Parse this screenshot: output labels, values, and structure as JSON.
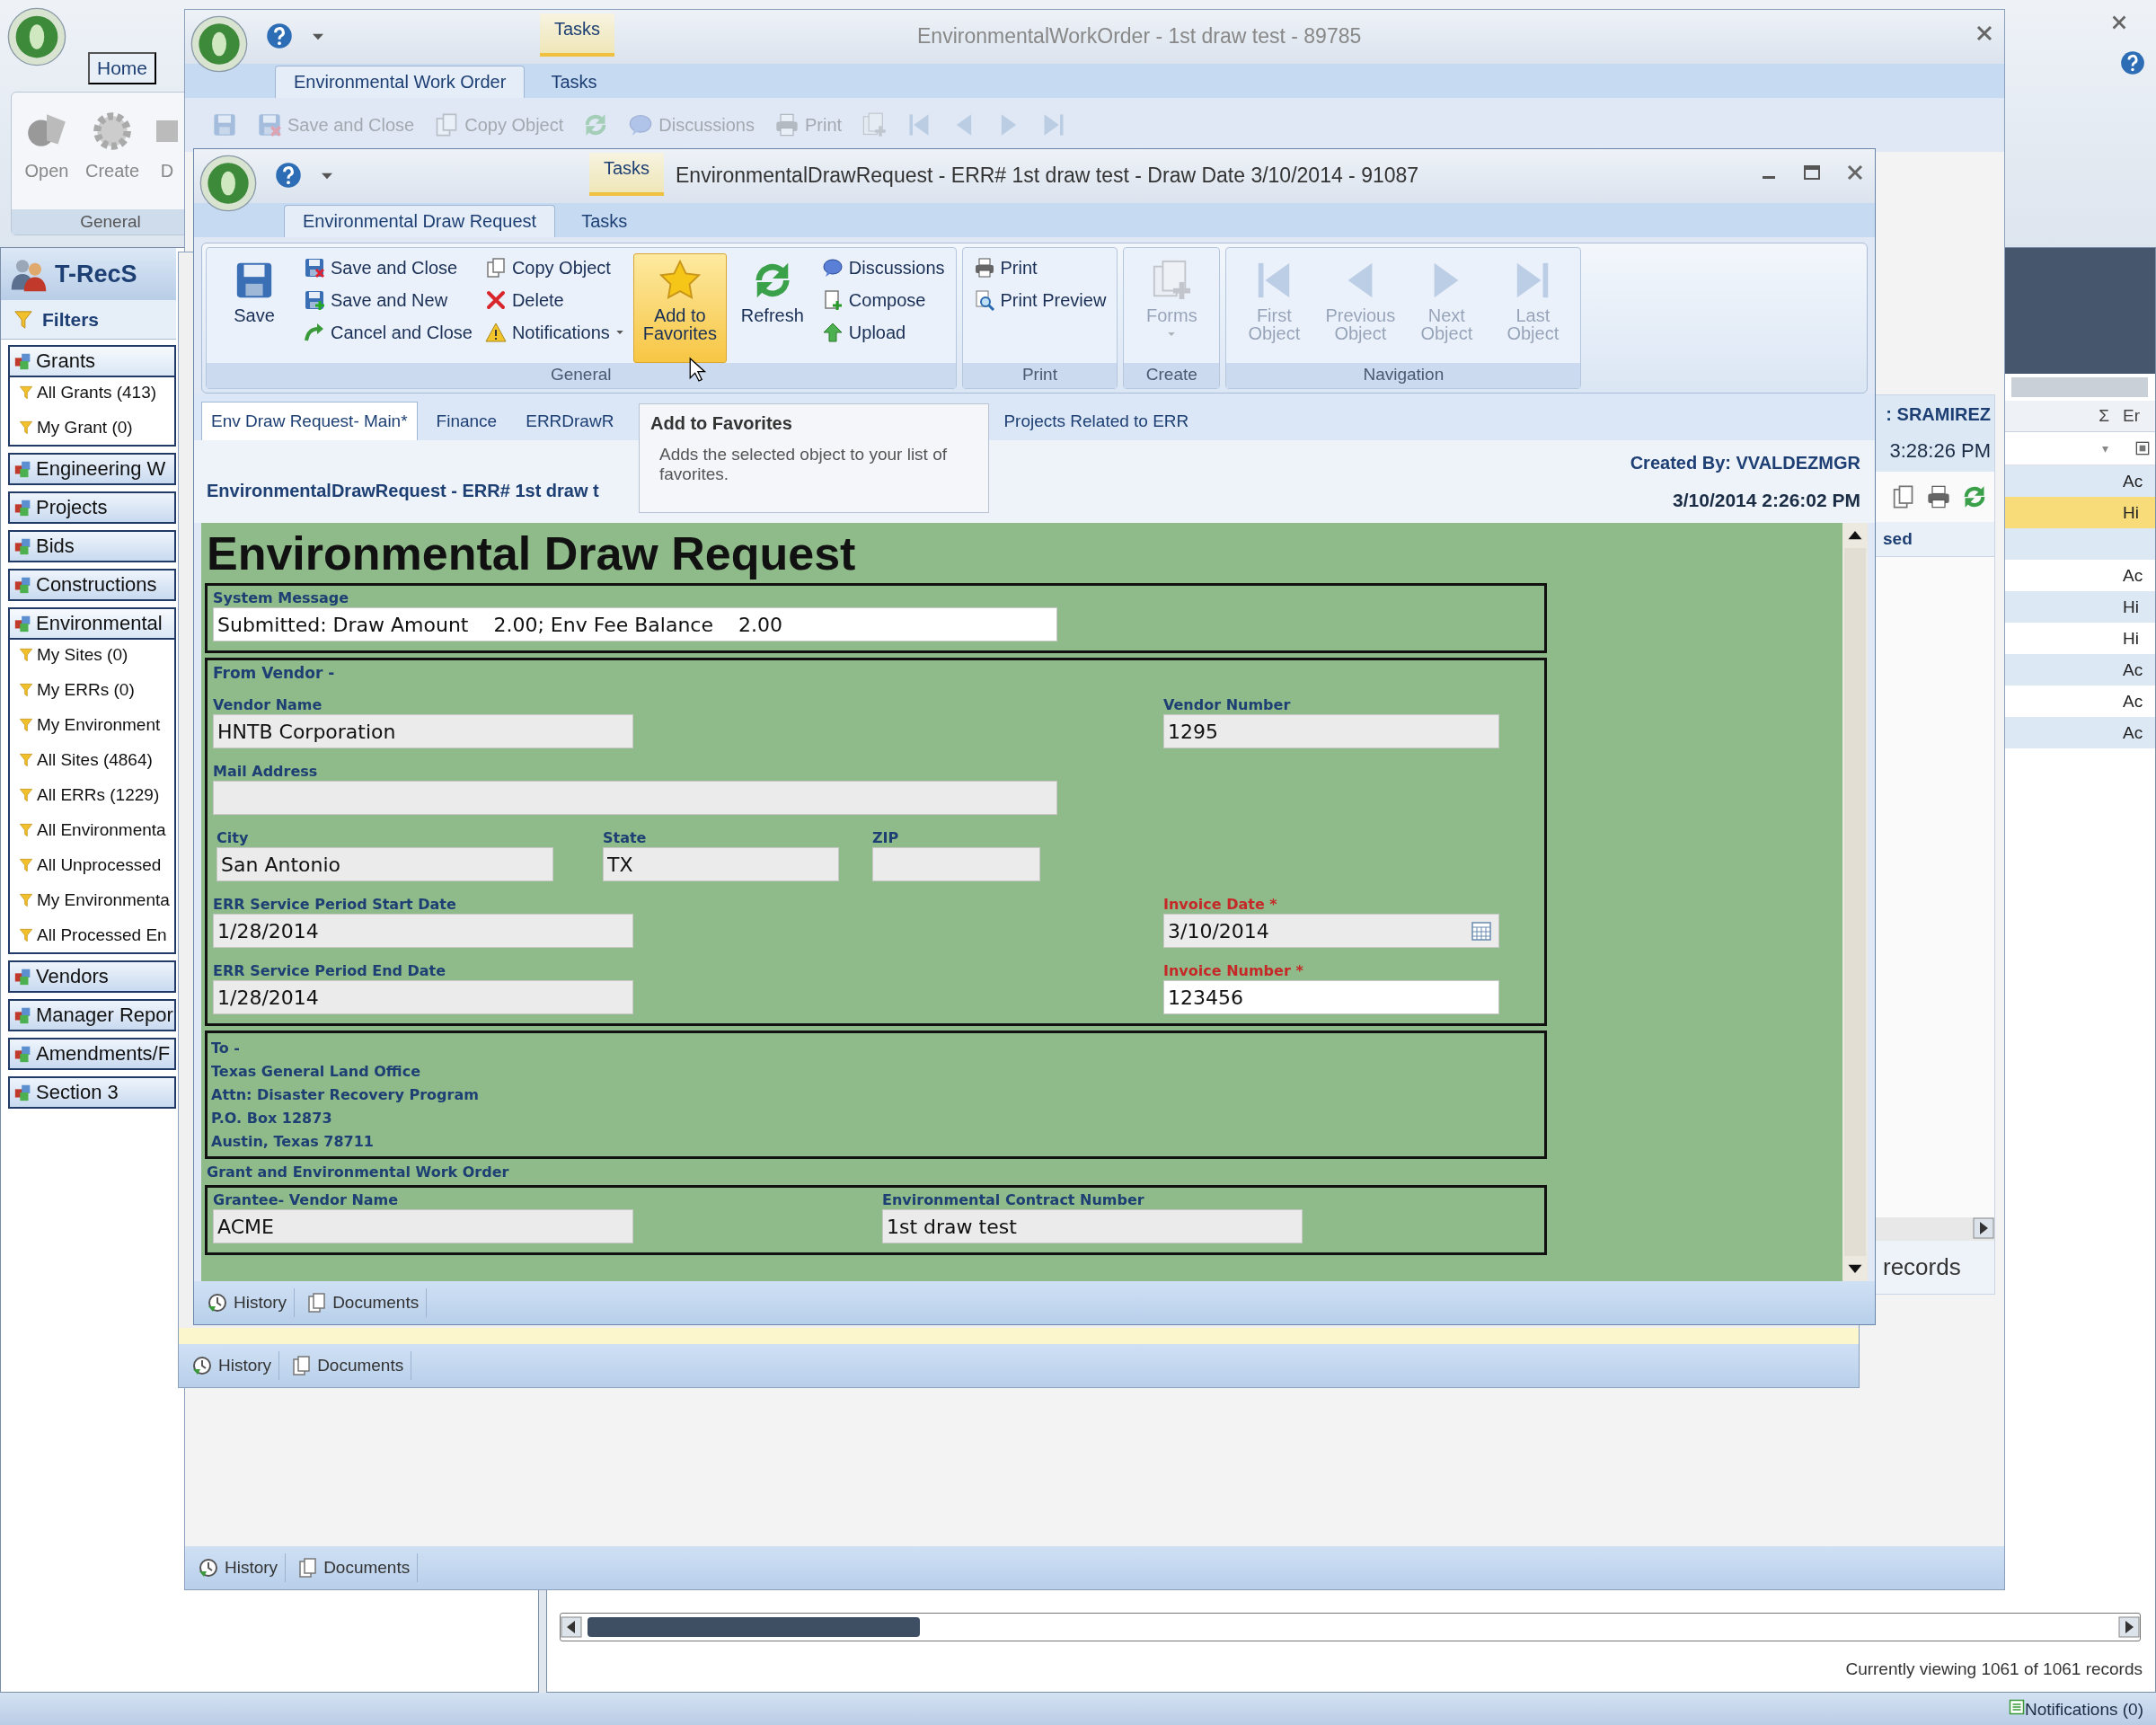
{
  "app": {
    "tabs": [
      {
        "label": "Home",
        "selected": true
      }
    ],
    "ribbon": {
      "buttons": [
        {
          "label": "Open",
          "kind": "open"
        },
        {
          "label": "Create",
          "kind": "create"
        },
        {
          "label": "D",
          "kind": "cut"
        }
      ],
      "group": "General"
    },
    "sidebar": {
      "title": "T-RecS",
      "filters": "Filters",
      "groups": [
        {
          "label": "Grants",
          "expanded": true,
          "children": [
            {
              "label": "All Grants (413)"
            },
            {
              "label": "My Grant (0)"
            }
          ]
        },
        {
          "label": "Engineering W",
          "expanded": false
        },
        {
          "label": "Projects",
          "expanded": false
        },
        {
          "label": "Bids",
          "expanded": false
        },
        {
          "label": "Constructions",
          "expanded": false
        },
        {
          "label": "Environmental",
          "expanded": true,
          "children": [
            {
              "label": "My Sites (0)"
            },
            {
              "label": "My ERRs (0)"
            },
            {
              "label": "My Environment"
            },
            {
              "label": "All Sites (4864)"
            },
            {
              "label": "All ERRs (1229)"
            },
            {
              "label": "All Environmenta"
            },
            {
              "label": "All Unprocessed"
            },
            {
              "label": "My Environmenta"
            },
            {
              "label": "All Processed En"
            }
          ]
        },
        {
          "label": "Vendors",
          "expanded": false
        },
        {
          "label": "Manager Repor",
          "expanded": false
        },
        {
          "label": "Amendments/F",
          "expanded": false
        },
        {
          "label": "Section 3",
          "expanded": false
        }
      ]
    },
    "grid": {
      "columns": [
        "Σ",
        "Er"
      ],
      "filter_caret": "▾",
      "rows": [
        {
          "text": "Ac",
          "selected": false
        },
        {
          "text": "Hi",
          "selected": true
        },
        {
          "selected": false
        },
        {
          "text": "Ac",
          "selected": false
        },
        {
          "text": "Hi",
          "selected": false
        },
        {
          "text": "Hi",
          "selected": false
        },
        {
          "text": "Ac",
          "selected": false
        },
        {
          "text": "Ac",
          "selected": false
        },
        {
          "text": "Ac",
          "selected": false
        }
      ]
    },
    "grid_status": "Currently viewing 1061 of 1061 records",
    "status_bar": {
      "notifications": "Notifications (0)"
    }
  },
  "work_order_window": {
    "title": "EnvironmentalWorkOrder - 1st draw test - 89785",
    "context_tab": "Tasks",
    "tabs": [
      {
        "label": "Environmental Work Order",
        "selected": true
      },
      {
        "label": "Tasks",
        "selected": false
      }
    ],
    "toolbar": [
      {
        "kind": "save",
        "disabled": true
      },
      {
        "label": "Save and Close",
        "kind": "save-close",
        "disabled": true
      },
      {
        "label": "Copy Object",
        "kind": "copy",
        "disabled": true
      },
      {
        "kind": "refresh",
        "disabled": true
      },
      {
        "label": "Discussions",
        "kind": "discussions",
        "disabled": true
      },
      {
        "label": "Print",
        "kind": "print",
        "disabled": true
      },
      {
        "kind": "forms",
        "disabled": true
      },
      {
        "kind": "first",
        "disabled": true
      },
      {
        "kind": "previous",
        "disabled": true
      },
      {
        "kind": "next",
        "disabled": true
      },
      {
        "kind": "last",
        "disabled": true
      }
    ],
    "panel": {
      "user": ": SRAMIREZ",
      "time": "3:28:26 PM",
      "column": "sed",
      "footer": "records"
    },
    "bottom_tabs": [
      "History",
      "Documents"
    ]
  },
  "middle_window": {
    "bottom_tabs": [
      "History",
      "Documents"
    ]
  },
  "draw_request_window": {
    "title": "EnvironmentalDrawRequest - ERR# 1st draw test - Draw Date 3/10/2014 - 91087",
    "context_tab": "Tasks",
    "tabs": [
      {
        "label": "Environmental Draw Request",
        "selected": true
      },
      {
        "label": "Tasks",
        "selected": false
      }
    ],
    "ribbon": [
      {
        "label": "General",
        "columns": [
          {
            "kind": "large",
            "buttons": [
              {
                "label": "Save",
                "kind": "save",
                "disabled": false,
                "hovered": false
              }
            ]
          },
          {
            "kind": "stack",
            "buttons": [
              {
                "label": "Save and Close",
                "kind": "save-close",
                "disabled": false,
                "hovered": false
              },
              {
                "label": "Save and New",
                "kind": "save-new",
                "disabled": false,
                "hovered": false
              },
              {
                "label": "Cancel and Close",
                "kind": "cancel-close",
                "disabled": false,
                "hovered": false
              }
            ]
          },
          {
            "kind": "stack",
            "buttons": [
              {
                "label": "Copy Object",
                "kind": "copy",
                "disabled": false,
                "hovered": false
              },
              {
                "label": "Delete",
                "kind": "delete",
                "disabled": false,
                "hovered": false
              },
              {
                "label": "Notifications",
                "kind": "notifications",
                "disabled": false,
                "hovered": false
              }
            ]
          },
          {
            "kind": "large",
            "buttons": [
              {
                "label": "Add to Favorites",
                "kind": "favorites",
                "disabled": false,
                "hovered": true
              }
            ]
          },
          {
            "kind": "large",
            "buttons": [
              {
                "label": "Refresh",
                "kind": "refresh",
                "disabled": false,
                "hovered": false
              }
            ]
          },
          {
            "kind": "stack",
            "buttons": [
              {
                "label": "Discussions",
                "kind": "discussions",
                "disabled": false,
                "hovered": false
              },
              {
                "label": "Compose",
                "kind": "compose",
                "disabled": false,
                "hovered": false
              },
              {
                "label": "Upload",
                "kind": "upload",
                "disabled": false,
                "hovered": false
              }
            ]
          }
        ]
      },
      {
        "label": "Print",
        "columns": [
          {
            "kind": "stack",
            "buttons": [
              {
                "label": "Print",
                "kind": "print",
                "disabled": false,
                "hovered": false
              },
              {
                "label": "Print Preview",
                "kind": "preview",
                "disabled": false,
                "hovered": false
              }
            ]
          }
        ]
      },
      {
        "label": "Create",
        "columns": [
          {
            "kind": "large",
            "buttons": [
              {
                "label": "Forms",
                "kind": "forms",
                "disabled": true,
                "hovered": false
              }
            ]
          }
        ]
      },
      {
        "label": "Navigation",
        "columns": [
          {
            "kind": "large",
            "buttons": [
              {
                "label": "First Object",
                "kind": "first",
                "disabled": true,
                "hovered": false
              }
            ]
          },
          {
            "kind": "large",
            "buttons": [
              {
                "label": "Previous Object",
                "kind": "previous",
                "disabled": true,
                "hovered": false
              }
            ]
          },
          {
            "kind": "large",
            "buttons": [
              {
                "label": "Next Object",
                "kind": "next",
                "disabled": true,
                "hovered": false
              }
            ]
          },
          {
            "kind": "large",
            "buttons": [
              {
                "label": "Last Object",
                "kind": "last",
                "disabled": true,
                "hovered": false
              }
            ]
          }
        ]
      }
    ],
    "tooltip": {
      "title": "Add to Favorites",
      "text": "Adds the selected object to your list of favorites."
    },
    "page_tabs": [
      {
        "label": "Env Draw Request- Main*",
        "selected": true
      },
      {
        "label": "Finance",
        "selected": false
      },
      {
        "label": "ERRDrawR",
        "selected": false
      },
      {
        "label": "Projects Related to ERR",
        "selected": false
      }
    ],
    "header": {
      "caption": "EnvironmentalDrawRequest - ERR# 1st draw t",
      "created_by": "Created By: VVALDEZMGR",
      "created_at": "3/10/2014 2:26:02 PM"
    },
    "form": {
      "title": "Environmental Draw Request",
      "blocks": [
        {
          "kind": "box",
          "rows": [
            {
              "kind": "wide",
              "fields": [
                {
                  "label": "System Message",
                  "value": "Submitted: Draw Amount    2.00; Env Fee Balance    2.00",
                  "kind": "text",
                  "required": false,
                  "editable": true
                }
              ]
            }
          ]
        },
        {
          "kind": "box",
          "heading": "From Vendor -",
          "rows": [
            {
              "kind": "pair",
              "fields": [
                {
                  "label": "Vendor Name",
                  "value": "HNTB Corporation",
                  "kind": "text",
                  "required": false,
                  "editable": false
                },
                {
                  "label": "Vendor Number",
                  "value": "1295",
                  "kind": "text",
                  "required": false,
                  "editable": false
                }
              ]
            },
            {
              "kind": "wide",
              "fields": [
                {
                  "label": "Mail Address",
                  "kind": "text",
                  "required": false,
                  "editable": false
                }
              ]
            },
            {
              "kind": "triple",
              "fields": [
                {
                  "label": "City",
                  "value": "San Antonio",
                  "kind": "text",
                  "required": false,
                  "editable": false
                },
                {
                  "label": "State",
                  "value": "TX",
                  "kind": "text",
                  "required": false,
                  "editable": false
                },
                {
                  "label": "ZIP",
                  "kind": "text",
                  "required": false,
                  "editable": false
                }
              ]
            },
            {
              "kind": "pair",
              "fields": [
                {
                  "label": "ERR Service Period Start Date",
                  "value": "1/28/2014",
                  "kind": "text",
                  "required": false,
                  "editable": false
                },
                {
                  "label": "Invoice Date *",
                  "value": "3/10/2014",
                  "kind": "date",
                  "required": true,
                  "editable": false
                }
              ]
            },
            {
              "kind": "pair",
              "fields": [
                {
                  "label": "ERR Service Period End Date",
                  "value": "1/28/2014",
                  "kind": "text",
                  "required": false,
                  "editable": false
                },
                {
                  "label": "Invoice Number *",
                  "value": "123456",
                  "kind": "text",
                  "required": true,
                  "editable": true
                }
              ]
            }
          ]
        },
        {
          "kind": "address",
          "lines": [
            "To -",
            "Texas General Land Office",
            "Attn: Disaster Recovery Program",
            "P.O. Box 12873",
            "Austin, Texas 78711"
          ]
        },
        {
          "kind": "heading",
          "text": "Grant and Environmental Work Order"
        },
        {
          "kind": "box",
          "rows": [
            {
              "kind": "offset",
              "fields": [
                {
                  "label": "Grantee- Vendor Name",
                  "value": "ACME",
                  "kind": "text",
                  "required": false,
                  "editable": false
                },
                {
                  "label": "Environmental Contract Number",
                  "value": "1st draw test",
                  "kind": "text",
                  "required": false,
                  "editable": false
                }
              ]
            }
          ]
        }
      ]
    },
    "bottom_tabs": [
      "History",
      "Documents"
    ]
  }
}
